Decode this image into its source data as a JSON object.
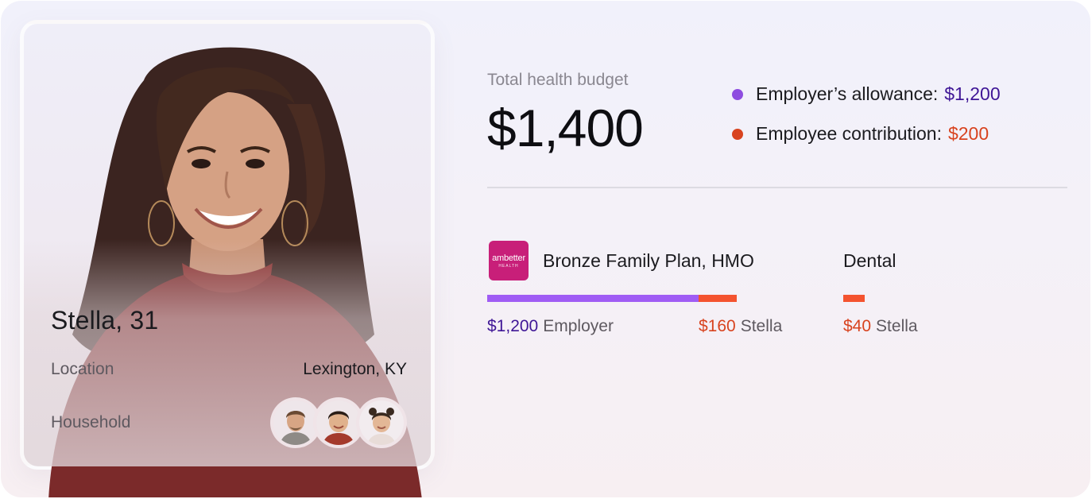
{
  "person": {
    "name": "Stella, 31",
    "location_label": "Location",
    "location_value": "Lexington, KY",
    "household_label": "Household",
    "household_members": [
      {
        "name": "man-avatar"
      },
      {
        "name": "boy-avatar"
      },
      {
        "name": "girl-avatar"
      }
    ]
  },
  "budget": {
    "label": "Total health budget",
    "total": "$1,400",
    "legend": [
      {
        "label": "Employer’s allowance:",
        "value": "$1,200",
        "color": "#8e4de0"
      },
      {
        "label": "Employee contribution:",
        "value": "$200",
        "color": "#d8431f"
      }
    ]
  },
  "plans": {
    "medical": {
      "logo_text": "ambetter",
      "logo_subtext": "HEALTH",
      "name": "Bronze Family Plan, HMO",
      "employer_amount": "$1,200",
      "employer_label": "Employer",
      "employee_amount": "$160",
      "employee_label": "Stella",
      "employer_value": 1200,
      "employee_value": 160
    },
    "dental": {
      "name": "Dental",
      "employee_amount": "$40",
      "employee_label": "Stella",
      "employee_value": 40
    }
  },
  "colors": {
    "employer": "#a05cf4",
    "employee": "#f4532f",
    "logo": "#c81f79"
  }
}
